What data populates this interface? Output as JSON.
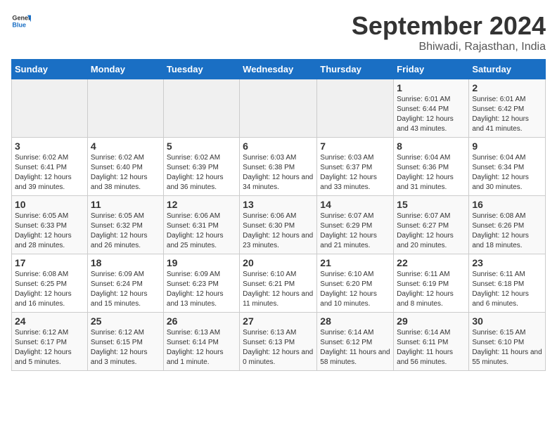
{
  "logo": {
    "general": "General",
    "blue": "Blue"
  },
  "header": {
    "month": "September 2024",
    "location": "Bhiwadi, Rajasthan, India"
  },
  "weekdays": [
    "Sunday",
    "Monday",
    "Tuesday",
    "Wednesday",
    "Thursday",
    "Friday",
    "Saturday"
  ],
  "days": [
    {
      "day": null,
      "number": null,
      "sunrise": null,
      "sunset": null,
      "daylight": null
    },
    {
      "day": null,
      "number": null,
      "sunrise": null,
      "sunset": null,
      "daylight": null
    },
    {
      "day": null,
      "number": null,
      "sunrise": null,
      "sunset": null,
      "daylight": null
    },
    {
      "day": null,
      "number": null,
      "sunrise": null,
      "sunset": null,
      "daylight": null
    },
    {
      "day": null,
      "number": null,
      "sunrise": null,
      "sunset": null,
      "daylight": null
    },
    {
      "number": "1",
      "sunrise": "Sunrise: 6:01 AM",
      "sunset": "Sunset: 6:44 PM",
      "daylight": "Daylight: 12 hours and 43 minutes."
    },
    {
      "number": "2",
      "sunrise": "Sunrise: 6:01 AM",
      "sunset": "Sunset: 6:42 PM",
      "daylight": "Daylight: 12 hours and 41 minutes."
    },
    {
      "number": "3",
      "sunrise": "Sunrise: 6:02 AM",
      "sunset": "Sunset: 6:41 PM",
      "daylight": "Daylight: 12 hours and 39 minutes."
    },
    {
      "number": "4",
      "sunrise": "Sunrise: 6:02 AM",
      "sunset": "Sunset: 6:40 PM",
      "daylight": "Daylight: 12 hours and 38 minutes."
    },
    {
      "number": "5",
      "sunrise": "Sunrise: 6:02 AM",
      "sunset": "Sunset: 6:39 PM",
      "daylight": "Daylight: 12 hours and 36 minutes."
    },
    {
      "number": "6",
      "sunrise": "Sunrise: 6:03 AM",
      "sunset": "Sunset: 6:38 PM",
      "daylight": "Daylight: 12 hours and 34 minutes."
    },
    {
      "number": "7",
      "sunrise": "Sunrise: 6:03 AM",
      "sunset": "Sunset: 6:37 PM",
      "daylight": "Daylight: 12 hours and 33 minutes."
    },
    {
      "number": "8",
      "sunrise": "Sunrise: 6:04 AM",
      "sunset": "Sunset: 6:36 PM",
      "daylight": "Daylight: 12 hours and 31 minutes."
    },
    {
      "number": "9",
      "sunrise": "Sunrise: 6:04 AM",
      "sunset": "Sunset: 6:34 PM",
      "daylight": "Daylight: 12 hours and 30 minutes."
    },
    {
      "number": "10",
      "sunrise": "Sunrise: 6:05 AM",
      "sunset": "Sunset: 6:33 PM",
      "daylight": "Daylight: 12 hours and 28 minutes."
    },
    {
      "number": "11",
      "sunrise": "Sunrise: 6:05 AM",
      "sunset": "Sunset: 6:32 PM",
      "daylight": "Daylight: 12 hours and 26 minutes."
    },
    {
      "number": "12",
      "sunrise": "Sunrise: 6:06 AM",
      "sunset": "Sunset: 6:31 PM",
      "daylight": "Daylight: 12 hours and 25 minutes."
    },
    {
      "number": "13",
      "sunrise": "Sunrise: 6:06 AM",
      "sunset": "Sunset: 6:30 PM",
      "daylight": "Daylight: 12 hours and 23 minutes."
    },
    {
      "number": "14",
      "sunrise": "Sunrise: 6:07 AM",
      "sunset": "Sunset: 6:29 PM",
      "daylight": "Daylight: 12 hours and 21 minutes."
    },
    {
      "number": "15",
      "sunrise": "Sunrise: 6:07 AM",
      "sunset": "Sunset: 6:27 PM",
      "daylight": "Daylight: 12 hours and 20 minutes."
    },
    {
      "number": "16",
      "sunrise": "Sunrise: 6:08 AM",
      "sunset": "Sunset: 6:26 PM",
      "daylight": "Daylight: 12 hours and 18 minutes."
    },
    {
      "number": "17",
      "sunrise": "Sunrise: 6:08 AM",
      "sunset": "Sunset: 6:25 PM",
      "daylight": "Daylight: 12 hours and 16 minutes."
    },
    {
      "number": "18",
      "sunrise": "Sunrise: 6:09 AM",
      "sunset": "Sunset: 6:24 PM",
      "daylight": "Daylight: 12 hours and 15 minutes."
    },
    {
      "number": "19",
      "sunrise": "Sunrise: 6:09 AM",
      "sunset": "Sunset: 6:23 PM",
      "daylight": "Daylight: 12 hours and 13 minutes."
    },
    {
      "number": "20",
      "sunrise": "Sunrise: 6:10 AM",
      "sunset": "Sunset: 6:21 PM",
      "daylight": "Daylight: 12 hours and 11 minutes."
    },
    {
      "number": "21",
      "sunrise": "Sunrise: 6:10 AM",
      "sunset": "Sunset: 6:20 PM",
      "daylight": "Daylight: 12 hours and 10 minutes."
    },
    {
      "number": "22",
      "sunrise": "Sunrise: 6:11 AM",
      "sunset": "Sunset: 6:19 PM",
      "daylight": "Daylight: 12 hours and 8 minutes."
    },
    {
      "number": "23",
      "sunrise": "Sunrise: 6:11 AM",
      "sunset": "Sunset: 6:18 PM",
      "daylight": "Daylight: 12 hours and 6 minutes."
    },
    {
      "number": "24",
      "sunrise": "Sunrise: 6:12 AM",
      "sunset": "Sunset: 6:17 PM",
      "daylight": "Daylight: 12 hours and 5 minutes."
    },
    {
      "number": "25",
      "sunrise": "Sunrise: 6:12 AM",
      "sunset": "Sunset: 6:15 PM",
      "daylight": "Daylight: 12 hours and 3 minutes."
    },
    {
      "number": "26",
      "sunrise": "Sunrise: 6:13 AM",
      "sunset": "Sunset: 6:14 PM",
      "daylight": "Daylight: 12 hours and 1 minute."
    },
    {
      "number": "27",
      "sunrise": "Sunrise: 6:13 AM",
      "sunset": "Sunset: 6:13 PM",
      "daylight": "Daylight: 12 hours and 0 minutes."
    },
    {
      "number": "28",
      "sunrise": "Sunrise: 6:14 AM",
      "sunset": "Sunset: 6:12 PM",
      "daylight": "Daylight: 11 hours and 58 minutes."
    },
    {
      "number": "29",
      "sunrise": "Sunrise: 6:14 AM",
      "sunset": "Sunset: 6:11 PM",
      "daylight": "Daylight: 11 hours and 56 minutes."
    },
    {
      "number": "30",
      "sunrise": "Sunrise: 6:15 AM",
      "sunset": "Sunset: 6:10 PM",
      "daylight": "Daylight: 11 hours and 55 minutes."
    },
    {
      "day": null,
      "number": null,
      "sunrise": null,
      "sunset": null,
      "daylight": null
    },
    {
      "day": null,
      "number": null,
      "sunrise": null,
      "sunset": null,
      "daylight": null
    },
    {
      "day": null,
      "number": null,
      "sunrise": null,
      "sunset": null,
      "daylight": null
    },
    {
      "day": null,
      "number": null,
      "sunrise": null,
      "sunset": null,
      "daylight": null
    },
    {
      "day": null,
      "number": null,
      "sunrise": null,
      "sunset": null,
      "daylight": null
    }
  ]
}
